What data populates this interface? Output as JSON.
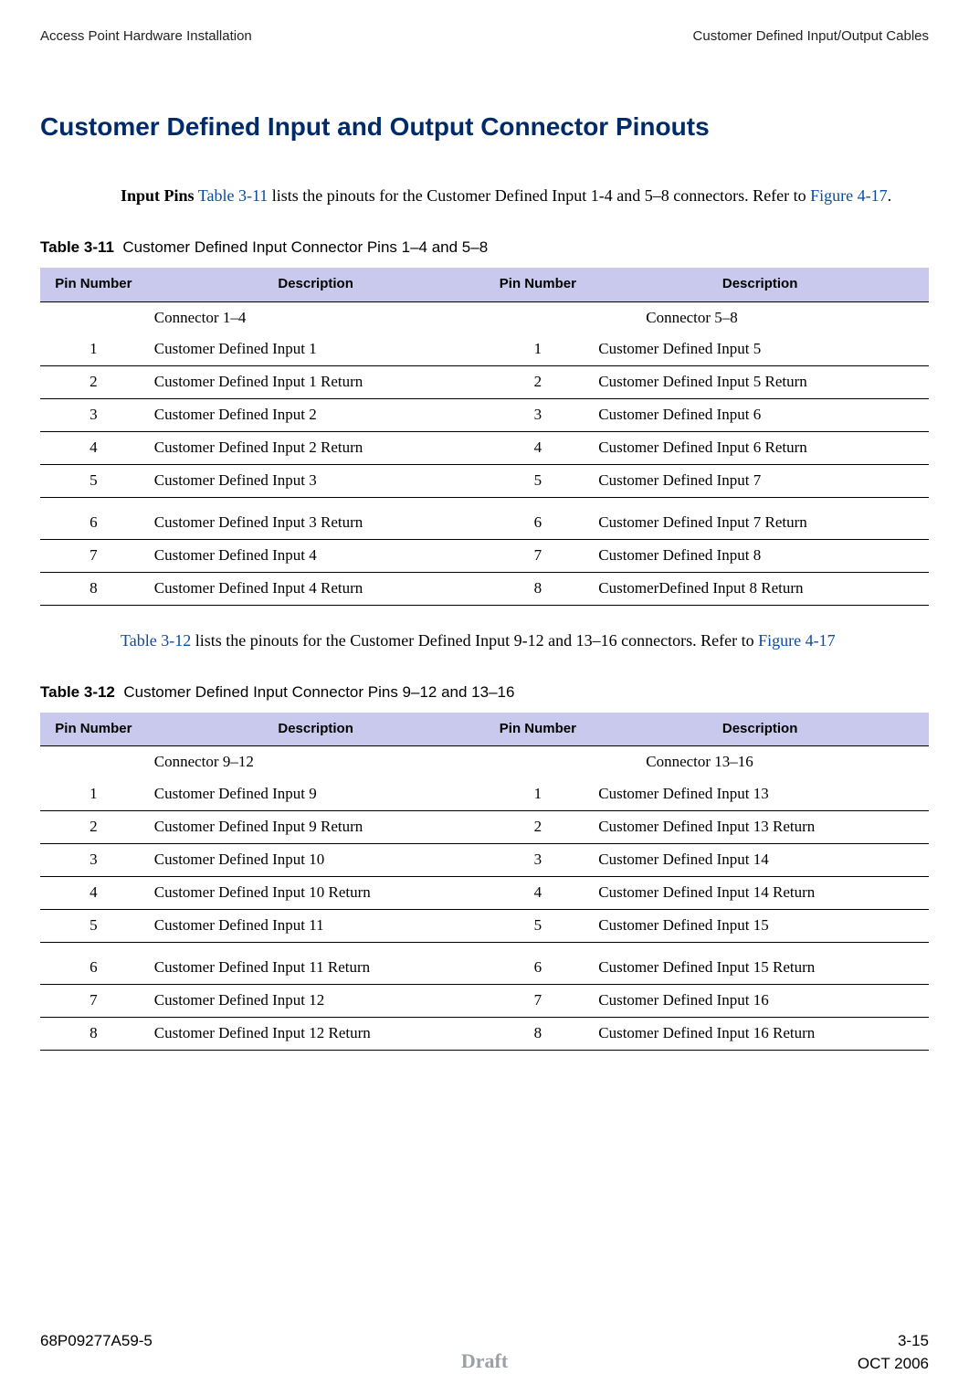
{
  "running_head": {
    "left": "Access Point Hardware Installation",
    "right": "Customer Defined Input/Output Cables"
  },
  "section_title": "Customer Defined Input and Output Connector Pinouts",
  "para1": {
    "lead_bold": "Input Pins",
    "pre": " ",
    "link": "Table 3-11",
    "mid": " lists the pinouts for the Customer Defined Input 1-4 and 5–8 connectors. Refer to ",
    "fig_link": "Figure 4-17",
    "tail": "."
  },
  "table311": {
    "caption_label": "Table 3-11",
    "caption_text": "Customer Defined Input Connector Pins 1–4 and 5–8",
    "headers": [
      "Pin Number",
      "Description",
      "Pin Number",
      "Description"
    ],
    "subhead_left": "Connector 1–4",
    "subhead_right": "Connector 5–8",
    "rows": [
      {
        "p1": "1",
        "d1": "Customer Defined Input 1",
        "p2": "1",
        "d2": "Customer Defined Input 5"
      },
      {
        "p1": "2",
        "d1": "Customer Defined Input 1 Return",
        "p2": "2",
        "d2": "Customer Defined Input 5 Return"
      },
      {
        "p1": "3",
        "d1": "Customer Defined Input 2",
        "p2": "3",
        "d2": "Customer Defined Input 6"
      },
      {
        "p1": "4",
        "d1": "Customer Defined Input 2 Return",
        "p2": "4",
        "d2": "Customer Defined Input 6 Return"
      },
      {
        "p1": "5",
        "d1": "Customer Defined Input 3",
        "p2": "5",
        "d2": "Customer Defined Input 7"
      },
      {
        "p1": "6",
        "d1": "Customer Defined Input 3 Return",
        "p2": "6",
        "d2": "Customer Defined Input 7 Return",
        "gap": true
      },
      {
        "p1": "7",
        "d1": "Customer Defined Input 4",
        "p2": "7",
        "d2": "Customer Defined Input 8"
      },
      {
        "p1": "8",
        "d1": "Customer Defined Input 4 Return",
        "p2": "8",
        "d2": "CustomerDefined Input 8 Return"
      }
    ]
  },
  "para2": {
    "link": "Table 3-12",
    "mid": " lists the pinouts for the Customer Defined Input 9-12 and 13–16 connectors. Refer to ",
    "fig_link": "Figure 4-17"
  },
  "table312": {
    "caption_label": "Table 3-12",
    "caption_text": "Customer Defined Input Connector Pins 9–12 and 13–16",
    "headers": [
      "Pin Number",
      "Description",
      "Pin Number",
      "Description"
    ],
    "subhead_left": "Connector 9–12",
    "subhead_right": "Connector 13–16",
    "rows": [
      {
        "p1": "1",
        "d1": "Customer Defined Input 9",
        "p2": "1",
        "d2": "Customer Defined Input 13"
      },
      {
        "p1": "2",
        "d1": "Customer Defined Input 9 Return",
        "p2": "2",
        "d2": "Customer Defined Input 13 Return"
      },
      {
        "p1": "3",
        "d1": "Customer Defined Input 10",
        "p2": "3",
        "d2": "Customer Defined Input 14"
      },
      {
        "p1": "4",
        "d1": "Customer Defined Input 10 Return",
        "p2": "4",
        "d2": "Customer Defined Input 14 Return"
      },
      {
        "p1": "5",
        "d1": "Customer Defined Input 11",
        "p2": "5",
        "d2": "Customer Defined Input 15"
      },
      {
        "p1": "6",
        "d1": "Customer Defined Input 11 Return",
        "p2": "6",
        "d2": "Customer Defined Input 15 Return",
        "gap": true
      },
      {
        "p1": "7",
        "d1": "Customer Defined Input 12",
        "p2": "7",
        "d2": "Customer Defined Input 16"
      },
      {
        "p1": "8",
        "d1": "Customer Defined Input 12 Return",
        "p2": "8",
        "d2": "Customer Defined Input 16 Return"
      }
    ]
  },
  "footer": {
    "docnum": "68P09277A59-5",
    "pagenum": "3-15",
    "draft": "Draft",
    "date": "OCT 2006"
  }
}
